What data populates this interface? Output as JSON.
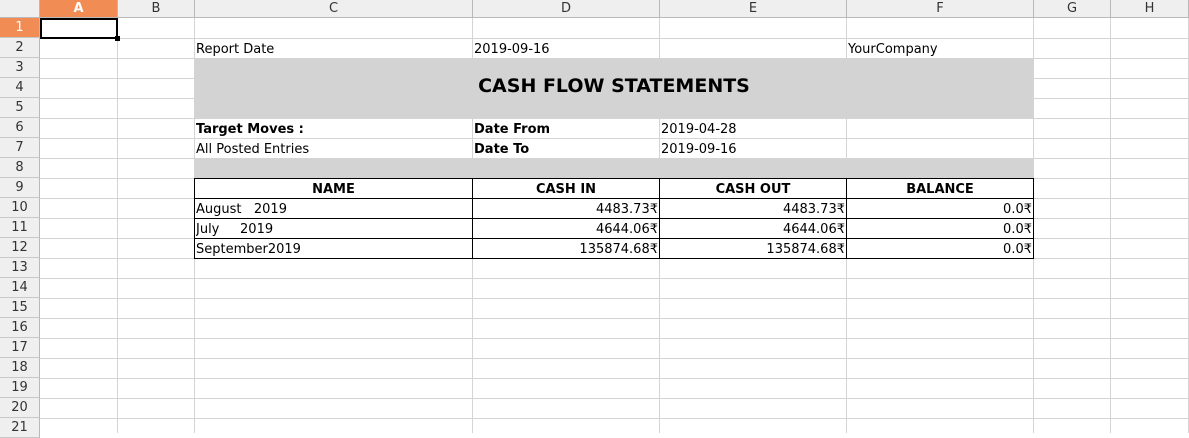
{
  "columns": [
    "A",
    "B",
    "C",
    "D",
    "E",
    "F",
    "G",
    "H"
  ],
  "rows": [
    "1",
    "2",
    "3",
    "4",
    "5",
    "6",
    "7",
    "8",
    "9",
    "10",
    "11",
    "12",
    "13",
    "14",
    "15",
    "16",
    "17",
    "18",
    "19",
    "20",
    "21"
  ],
  "selected_cell": "A1",
  "report": {
    "report_date_label": "Report Date",
    "report_date_value": "2019-09-16",
    "company": "YourCompany",
    "title": "CASH FLOW STATEMENTS",
    "target_moves_label": "Target Moves :",
    "target_moves_value": "All Posted Entries",
    "date_from_label": "Date From",
    "date_from_value": "2019-04-28",
    "date_to_label": "Date To",
    "date_to_value": "2019-09-16"
  },
  "table": {
    "headers": [
      "NAME",
      "CASH IN",
      "CASH OUT",
      "BALANCE"
    ],
    "rows": [
      [
        "August   2019",
        "4483.73₹",
        "4483.73₹",
        "0.0₹"
      ],
      [
        "July     2019",
        "4644.06₹",
        "4644.06₹",
        "0.0₹"
      ],
      [
        "September2019",
        "135874.68₹",
        "135874.68₹",
        "0.0₹"
      ]
    ]
  }
}
